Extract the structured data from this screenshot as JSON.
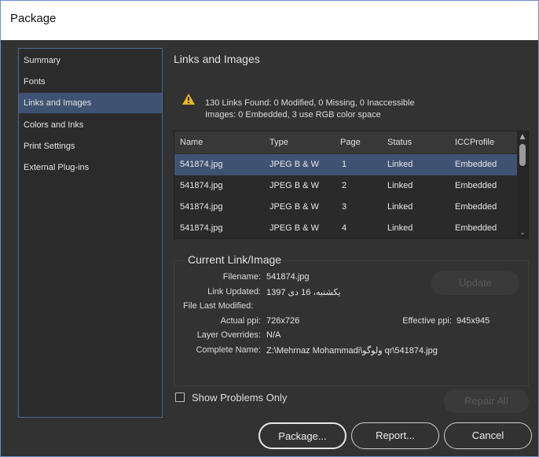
{
  "window": {
    "title": "Package"
  },
  "sidebar": {
    "items": [
      {
        "label": "Summary"
      },
      {
        "label": "Fonts"
      },
      {
        "label": "Links and Images"
      },
      {
        "label": "Colors and Inks"
      },
      {
        "label": "Print Settings"
      },
      {
        "label": "External Plug-ins"
      }
    ],
    "selected": "Links and Images"
  },
  "section": {
    "title": "Links and Images",
    "summary_line1": "130 Links Found: 0 Modified, 0 Missing, 0 Inaccessible",
    "summary_line2": "Images: 0 Embedded, 3 use RGB color space",
    "warning_icon": "warning-triangle-icon",
    "warning_color": "#e8b923"
  },
  "table": {
    "columns": [
      "Name",
      "Type",
      "Page",
      "Status",
      "ICCProfile"
    ],
    "rows": [
      {
        "name": "541874.jpg",
        "type": "JPEG B & W",
        "page": "1",
        "status": "Linked",
        "icc": "Embedded"
      },
      {
        "name": "541874.jpg",
        "type": "JPEG B & W",
        "page": "2",
        "status": "Linked",
        "icc": "Embedded"
      },
      {
        "name": "541874.jpg",
        "type": "JPEG B & W",
        "page": "3",
        "status": "Linked",
        "icc": "Embedded"
      },
      {
        "name": "541874.jpg",
        "type": "JPEG B & W",
        "page": "4",
        "status": "Linked",
        "icc": "Embedded"
      }
    ]
  },
  "current_link": {
    "title": "Current Link/Image",
    "filename_label": "Filename:",
    "filename": "541874.jpg",
    "link_updated_label": "Link Updated:",
    "link_updated": "یکشنبه، 16 دی 1397",
    "file_last_modified_label": "File Last Modified:",
    "file_last_modified": "",
    "actual_ppi_label": "Actual ppi:",
    "actual_ppi": "726x726",
    "effective_ppi_label": "Effective ppi:",
    "effective_ppi": "945x945",
    "layer_overrides_label": "Layer Overrides:",
    "layer_overrides": "N/A",
    "complete_name_label": "Complete Name:",
    "complete_name": "Z:\\Mehrnaz Mohammadi\\ولوگو qr\\541874.jpg",
    "update_button": "Update"
  },
  "options": {
    "show_problems_only": "Show Problems Only",
    "repair_all": "Repair All"
  },
  "footer": {
    "package": "Package...",
    "report": "Report...",
    "cancel": "Cancel"
  }
}
